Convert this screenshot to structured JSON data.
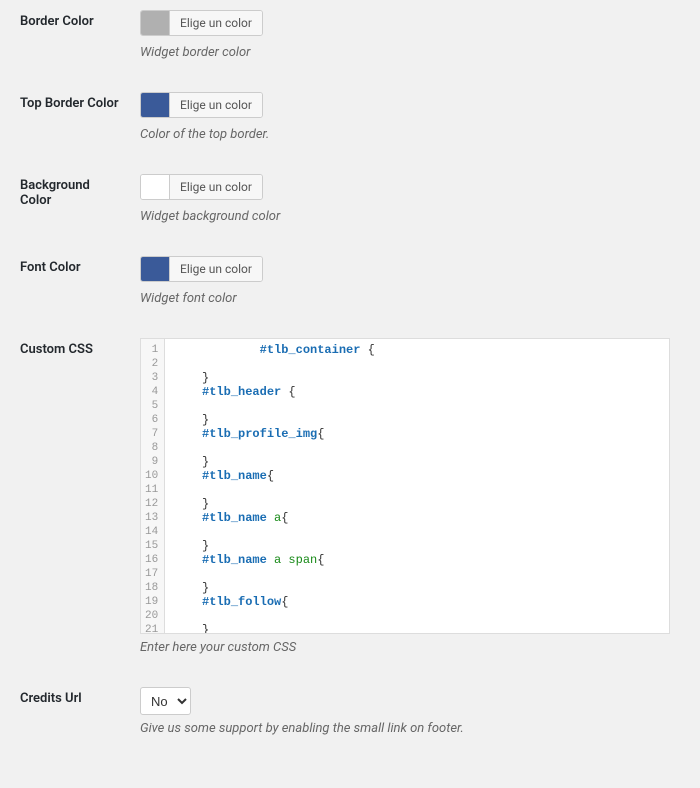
{
  "colorButtonLabel": "Elige un color",
  "fields": {
    "borderColor": {
      "label": "Border Color",
      "swatch": "#b0b0b0",
      "description": "Widget border color"
    },
    "topBorderColor": {
      "label": "Top Border Color",
      "swatch": "#3a5a99",
      "description": "Color of the top border."
    },
    "backgroundColor": {
      "label": "Background Color",
      "swatch": "#ffffff",
      "description": "Widget background color"
    },
    "fontColor": {
      "label": "Font Color",
      "swatch": "#3a5a99",
      "description": "Widget font color"
    },
    "customCss": {
      "label": "Custom CSS",
      "description": "Enter here your custom CSS",
      "lines": [
        {
          "n": 1,
          "indent": 3,
          "id": "#tlb_container",
          "tag": "",
          "post": " {"
        },
        {
          "n": 2,
          "indent": 0,
          "text": ""
        },
        {
          "n": 3,
          "indent": 1,
          "text": "}"
        },
        {
          "n": 4,
          "indent": 1,
          "id": "#tlb_header",
          "tag": "",
          "post": " {"
        },
        {
          "n": 5,
          "indent": 0,
          "text": ""
        },
        {
          "n": 6,
          "indent": 1,
          "text": "}"
        },
        {
          "n": 7,
          "indent": 1,
          "id": "#tlb_profile_img",
          "tag": "",
          "post": "{"
        },
        {
          "n": 8,
          "indent": 0,
          "text": ""
        },
        {
          "n": 9,
          "indent": 1,
          "text": "}"
        },
        {
          "n": 10,
          "indent": 1,
          "id": "#tlb_name",
          "tag": "",
          "post": "{"
        },
        {
          "n": 11,
          "indent": 0,
          "text": ""
        },
        {
          "n": 12,
          "indent": 1,
          "text": "}"
        },
        {
          "n": 13,
          "indent": 1,
          "id": "#tlb_name",
          "tag": "a",
          "post": "{"
        },
        {
          "n": 14,
          "indent": 0,
          "text": ""
        },
        {
          "n": 15,
          "indent": 1,
          "text": "}"
        },
        {
          "n": 16,
          "indent": 1,
          "id": "#tlb_name",
          "tag": "a span",
          "post": "{"
        },
        {
          "n": 17,
          "indent": 0,
          "text": ""
        },
        {
          "n": 18,
          "indent": 1,
          "text": "}"
        },
        {
          "n": 19,
          "indent": 1,
          "id": "#tlb_follow",
          "tag": "",
          "post": "{"
        },
        {
          "n": 20,
          "indent": 0,
          "text": ""
        },
        {
          "n": 21,
          "indent": 1,
          "text": "}"
        }
      ]
    },
    "creditsUrl": {
      "label": "Credits Url",
      "value": "No",
      "description": "Give us some support by enabling the small link on footer."
    }
  }
}
